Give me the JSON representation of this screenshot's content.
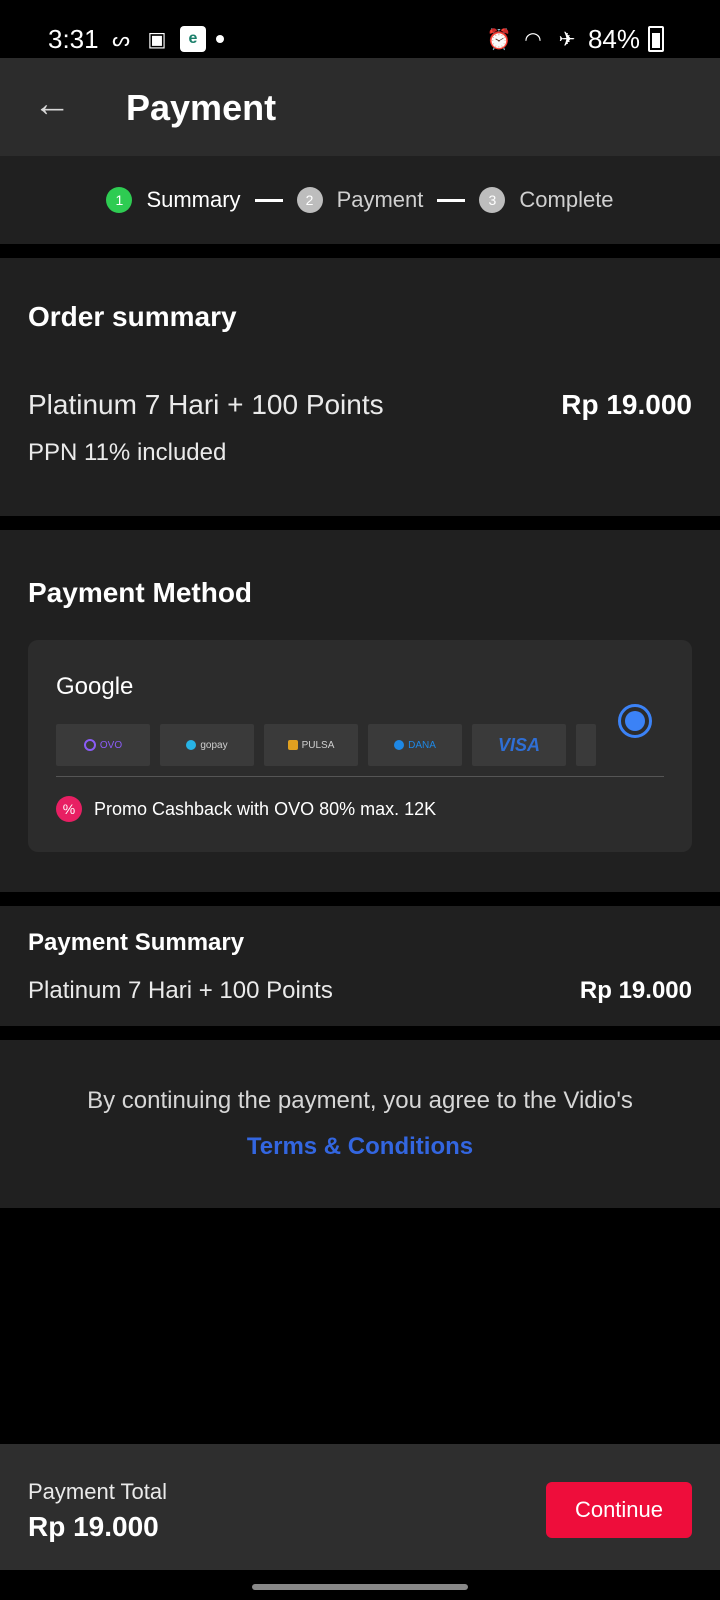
{
  "status_bar": {
    "time": "3:31",
    "battery": "84%",
    "left_icons": [
      "sinotif-icon",
      "calculator-icon",
      "app-icon",
      "dot-icon"
    ],
    "right_icons": [
      "alarm-icon",
      "wifi-icon",
      "airplane-icon",
      "battery-icon"
    ]
  },
  "header": {
    "title": "Payment"
  },
  "stepper": {
    "steps": [
      {
        "num": "1",
        "label": "Summary"
      },
      {
        "num": "2",
        "label": "Payment"
      },
      {
        "num": "3",
        "label": "Complete"
      }
    ]
  },
  "order_summary": {
    "title": "Order summary",
    "item": "Platinum 7 Hari + 100 Points",
    "price": "Rp 19.000",
    "tax_note": "PPN 11% included"
  },
  "payment_method": {
    "title": "Payment Method",
    "provider": "Google",
    "logos": [
      "OVO",
      "gopay",
      "PULSA",
      "DANA",
      "VISA"
    ],
    "promo": "Promo Cashback with OVO 80% max. 12K",
    "colors": {
      "radio": "#3b82f6",
      "promo_icon": "#e81f63"
    }
  },
  "payment_summary": {
    "title": "Payment Summary",
    "item": "Platinum 7 Hari + 100 Points",
    "price": "Rp 19.000"
  },
  "terms": {
    "text": "By continuing the payment, you agree to the Vidio's",
    "link": "Terms & Conditions",
    "link_color": "#3366e0"
  },
  "bottom_bar": {
    "label": "Payment Total",
    "total": "Rp 19.000",
    "continue_label": "Continue",
    "continue_color": "#ee0d3b"
  }
}
